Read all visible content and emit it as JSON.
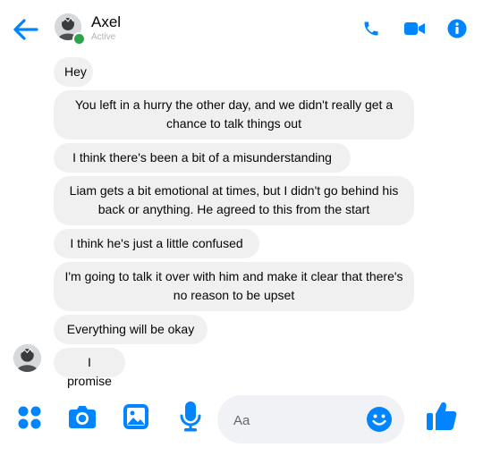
{
  "header": {
    "contact_name": "Axel",
    "status": "Active"
  },
  "messages": [
    {
      "text": "Hey"
    },
    {
      "text": "You left in a hurry the other day, and we didn't really get a chance to talk things out"
    },
    {
      "text": "I think there's been a bit of a misunderstanding"
    },
    {
      "text": "Liam gets a bit emotional at times, but I didn't go behind his back or anything. He agreed to this from the start"
    },
    {
      "text": "I think he's just a little confused"
    },
    {
      "text": "I'm going to talk it over with him and make it clear that there's no reason to be upset"
    },
    {
      "text": "Everything will be okay"
    },
    {
      "text": "I promise"
    }
  ],
  "composer": {
    "placeholder": "Aa"
  },
  "colors": {
    "accent": "#0084ff",
    "bubble": "#f0f0f0",
    "online": "#31a24c"
  },
  "icons": [
    "back-arrow-icon",
    "phone-icon",
    "video-icon",
    "info-icon",
    "apps-icon",
    "camera-icon",
    "image-icon",
    "microphone-icon",
    "emoji-icon",
    "thumbs-up-icon"
  ]
}
